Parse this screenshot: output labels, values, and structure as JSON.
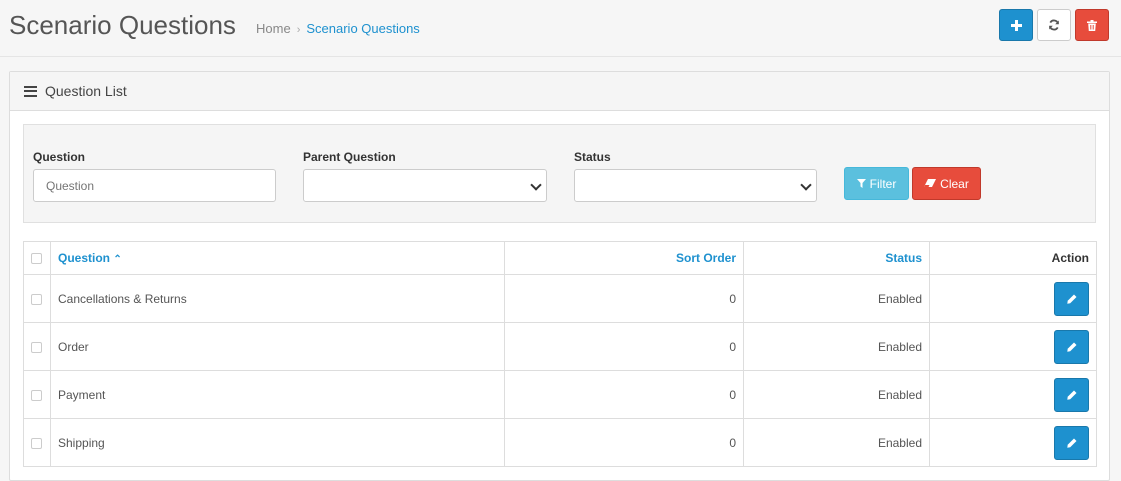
{
  "header": {
    "title": "Scenario Questions",
    "breadcrumb": [
      {
        "label": "Home"
      },
      {
        "label": "Scenario Questions"
      }
    ],
    "breadcrumb_separator": "›",
    "buttons": {
      "add_icon": "plus-icon",
      "refresh_icon": "refresh-icon",
      "delete_icon": "trash-icon"
    }
  },
  "panel": {
    "title": "Question List",
    "icon": "list-icon"
  },
  "filter": {
    "question_label": "Question",
    "question_placeholder": "Question",
    "parent_label": "Parent Question",
    "parent_value": "",
    "status_label": "Status",
    "status_value": "",
    "filter_button": "Filter",
    "clear_button": "Clear"
  },
  "table": {
    "columns": {
      "question": "Question",
      "sort_order": "Sort Order",
      "status": "Status",
      "action": "Action"
    },
    "sort_indicator": "⌃",
    "rows": [
      {
        "question": "Cancellations & Returns",
        "sort_order": "0",
        "status": "Enabled"
      },
      {
        "question": "Order",
        "sort_order": "0",
        "status": "Enabled"
      },
      {
        "question": "Payment",
        "sort_order": "0",
        "status": "Enabled"
      },
      {
        "question": "Shipping",
        "sort_order": "0",
        "status": "Enabled"
      }
    ]
  },
  "colors": {
    "primary": "#1e91cf",
    "danger": "#e74c3c",
    "info": "#5bc0de"
  }
}
